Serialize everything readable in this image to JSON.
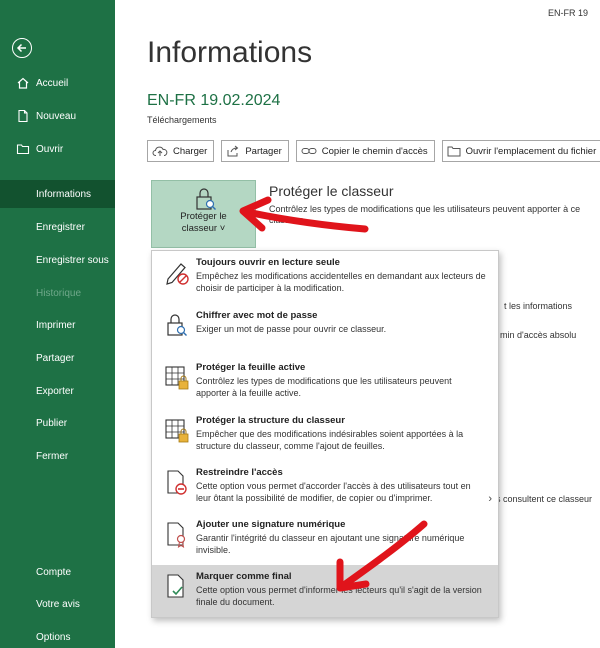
{
  "lang_code": "EN-FR 19",
  "sidebar": {
    "items": [
      {
        "label": "Accueil",
        "icon": "home-icon"
      },
      {
        "label": "Nouveau",
        "icon": "new-doc-icon"
      },
      {
        "label": "Ouvrir",
        "icon": "folder-icon"
      },
      {
        "label": "Informations"
      },
      {
        "label": "Enregistrer"
      },
      {
        "label": "Enregistrer sous"
      },
      {
        "label": "Historique"
      },
      {
        "label": "Imprimer"
      },
      {
        "label": "Partager"
      },
      {
        "label": "Exporter"
      },
      {
        "label": "Publier"
      },
      {
        "label": "Fermer"
      },
      {
        "label": "Compte"
      },
      {
        "label": "Votre avis"
      },
      {
        "label": "Options"
      }
    ]
  },
  "main": {
    "title": "Informations",
    "doc_name": "EN-FR 19.02.2024",
    "doc_path": "Téléchargements",
    "buttons": {
      "charger": "Charger",
      "partager": "Partager",
      "copier": "Copier le chemin d'accès",
      "ouvrir": "Ouvrir l'emplacement du fichier"
    },
    "protect": {
      "button_label_1": "Protéger le",
      "button_label_2": "classeur ˅",
      "heading": "Protéger le classeur",
      "description": "Contrôlez les types de modifications que les utilisateurs peuvent apporter à ce classeur."
    },
    "side_texts": {
      "info": "t les informations",
      "path": "min d'accès absolu",
      "consult": "s consultent ce classeur"
    }
  },
  "menu": {
    "items": [
      {
        "title": "Toujours ouvrir en lecture seule",
        "desc": "Empêchez les modifications accidentelles en demandant aux lecteurs de choisir de participer à la modification."
      },
      {
        "title": "Chiffrer avec mot de passe",
        "desc": "Exiger un mot de passe pour ouvrir ce classeur."
      },
      {
        "title": "Protéger la feuille active",
        "desc": "Contrôlez les types de modifications que les utilisateurs peuvent apporter à la feuille active."
      },
      {
        "title": "Protéger la structure du classeur",
        "desc": "Empêcher que des modifications indésirables soient apportées à la structure du classeur, comme l'ajout de feuilles."
      },
      {
        "title": "Restreindre l'accès",
        "desc": "Cette option vous permet d'accorder l'accès à des utilisateurs tout en leur ôtant la possibilité de modifier, de copier ou d'imprimer."
      },
      {
        "title": "Ajouter une signature numérique",
        "desc": "Garantir l'intégrité du classeur en ajoutant une signature numérique invisible."
      },
      {
        "title": "Marquer comme final",
        "desc": "Cette option vous permet d'informer les lecteurs qu'il s'agit de la version finale du document."
      }
    ]
  },
  "colors": {
    "sidebar": "#1e7145",
    "sidebar_active": "#12522f",
    "accent_green": "#1e7145",
    "arrow_red": "#e0141b"
  }
}
